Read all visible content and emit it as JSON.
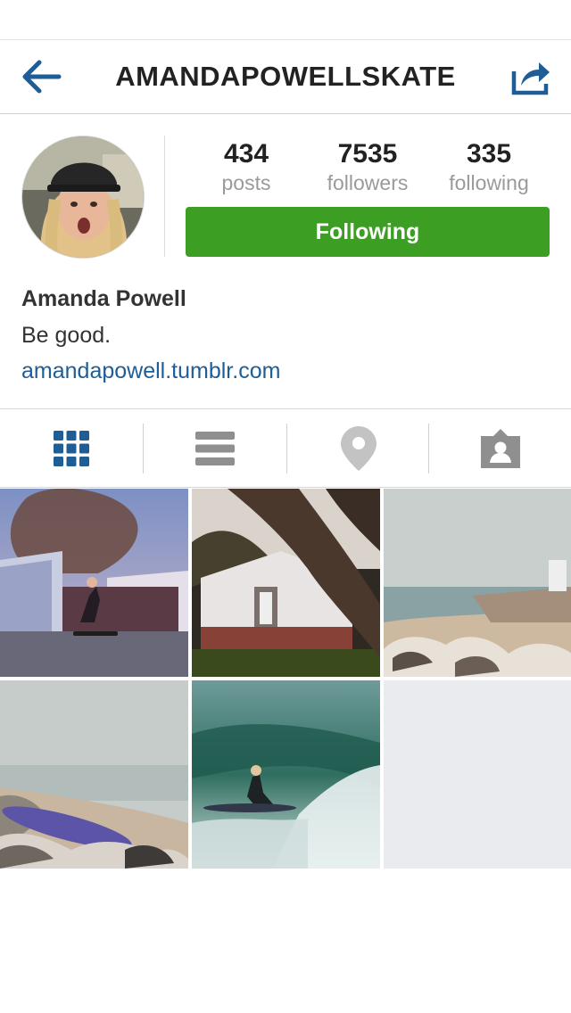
{
  "navbar": {
    "title": "AMANDAPOWELLSKATE",
    "back_icon": "arrow-left-icon",
    "share_icon": "share-icon"
  },
  "profile": {
    "stats": [
      {
        "value": "434",
        "label": "posts"
      },
      {
        "value": "7535",
        "label": "followers"
      },
      {
        "value": "335",
        "label": "following"
      }
    ],
    "follow_button": "Following",
    "name": "Amanda Powell",
    "bio": "Be good.",
    "website": "amandapowell.tumblr.com"
  },
  "view_tabs": [
    {
      "name": "grid-view",
      "icon": "grid-icon",
      "active": true
    },
    {
      "name": "list-view",
      "icon": "list-icon",
      "active": false
    },
    {
      "name": "map-view",
      "icon": "location-pin-icon",
      "active": false
    },
    {
      "name": "tagged-view",
      "icon": "tagged-person-icon",
      "active": false
    }
  ],
  "photos": [
    {
      "subject": "skateboarder-garage"
    },
    {
      "subject": "tree-house"
    },
    {
      "subject": "rocky-beach"
    },
    {
      "subject": "surfboard-rocks"
    },
    {
      "subject": "surfer-wave"
    }
  ],
  "colors": {
    "accent": "#1f5d96",
    "follow_green": "#3c9e22",
    "muted_icon": "#9a9a9a"
  }
}
